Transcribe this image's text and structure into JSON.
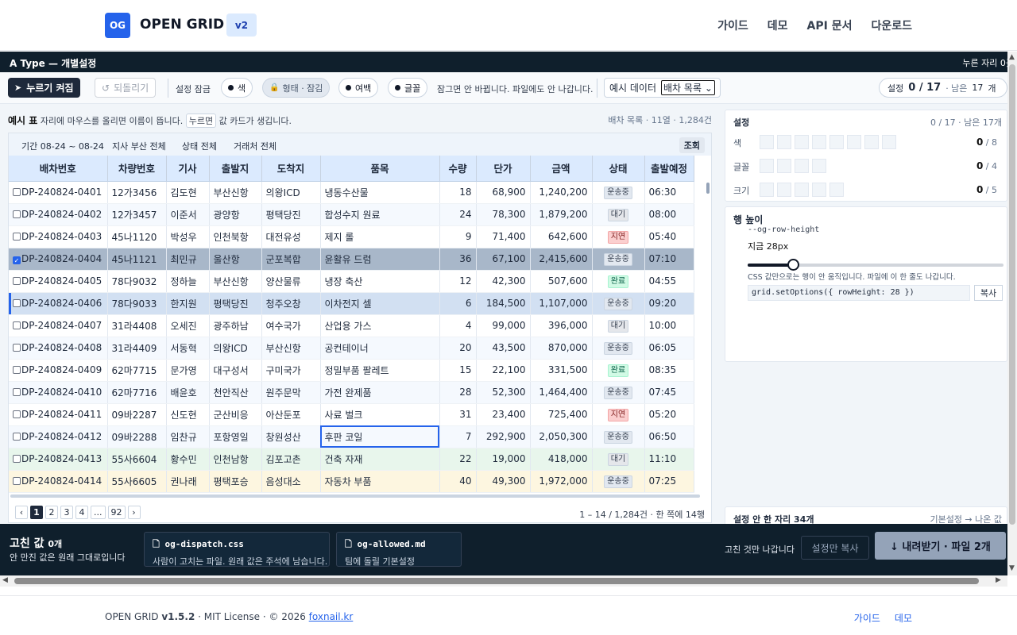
{
  "nav": {
    "logo": "OG",
    "brand": "OPEN GRID",
    "version": "v2",
    "links": [
      "가이드",
      "데모",
      "API 문서",
      "다운로드"
    ]
  },
  "app": {
    "title": "A Type — 개별설정",
    "title_right": "누른 자리 0곳"
  },
  "toolbar": {
    "press_btn": "누르기 켜짐",
    "undo_btn": "되돌리기",
    "lock_label": "설정 잠금",
    "pills": [
      "색",
      "형태 · 잠김",
      "여백",
      "글꼴"
    ],
    "lock_note": "잠그면 안 바뀝니다. 파일에도 안 나갑니다.",
    "sample_label": "예시 데이터",
    "sample_value": "배차 목록",
    "set_label": "설정",
    "set_value": "0 / 17",
    "set_remain_label": "· 남은",
    "set_remain": "17",
    "set_unit": "개"
  },
  "left": {
    "hdr_title": "예시 표",
    "hdr_text1": "자리에 마우스를 올리면 이름이 뜹니다.",
    "hdr_key": "누르면",
    "hdr_text2": "값 카드가 생깁니다.",
    "hdr_right": "배차 목록 · 11열 · 1,284건",
    "filters": [
      "기간 08-24 ~ 08-24",
      "지사 부산 전체",
      "상태 전체",
      "거래처 전체"
    ],
    "filter_go": "조회",
    "columns": [
      "배차번호",
      "차량번호",
      "기사",
      "출발지",
      "도착지",
      "품목",
      "수량",
      "단가",
      "금액",
      "상태",
      "출발예정"
    ],
    "rows": [
      [
        "DP-240824-0401",
        "12가3456",
        "김도현",
        "부산신항",
        "의왕ICD",
        "냉동수산물",
        "18",
        "68,900",
        "1,240,200",
        "운송중",
        "06:30"
      ],
      [
        "DP-240824-0402",
        "12가3457",
        "이준서",
        "광양항",
        "평택당진",
        "합성수지 원료",
        "24",
        "78,300",
        "1,879,200",
        "대기",
        "08:00"
      ],
      [
        "DP-240824-0403",
        "45나1120",
        "박성우",
        "인천북항",
        "대전유성",
        "제지 롤",
        "9",
        "71,400",
        "642,600",
        "지연",
        "05:40"
      ],
      [
        "DP-240824-0404",
        "45나1121",
        "최민규",
        "울산항",
        "군포복합",
        "윤활유 드럼",
        "36",
        "67,100",
        "2,415,600",
        "운송중",
        "07:10"
      ],
      [
        "DP-240824-0405",
        "78다9032",
        "정하늘",
        "부산신항",
        "양산물류",
        "냉장 축산",
        "12",
        "42,300",
        "507,600",
        "완료",
        "04:55"
      ],
      [
        "DP-240824-0406",
        "78다9033",
        "한지원",
        "평택당진",
        "청주오창",
        "이차전지 셀",
        "6",
        "184,500",
        "1,107,000",
        "운송중",
        "09:20"
      ],
      [
        "DP-240824-0407",
        "31라4408",
        "오세진",
        "광주하남",
        "여수국가",
        "산업용 가스",
        "4",
        "99,000",
        "396,000",
        "대기",
        "10:00"
      ],
      [
        "DP-240824-0408",
        "31라4409",
        "서동혁",
        "의왕ICD",
        "부산신항",
        "공컨테이너",
        "20",
        "43,500",
        "870,000",
        "운송중",
        "06:05"
      ],
      [
        "DP-240824-0409",
        "62마7715",
        "문가영",
        "대구성서",
        "구미국가",
        "정밀부품 팔레트",
        "15",
        "22,100",
        "331,500",
        "완료",
        "08:35"
      ],
      [
        "DP-240824-0410",
        "62마7716",
        "배윤호",
        "천안직산",
        "원주문막",
        "가전 완제품",
        "28",
        "52,300",
        "1,464,400",
        "운송중",
        "07:45"
      ],
      [
        "DP-240824-0411",
        "09바2287",
        "신도현",
        "군산비응",
        "아산둔포",
        "사료 벌크",
        "31",
        "23,400",
        "725,400",
        "지연",
        "05:20"
      ],
      [
        "DP-240824-0412",
        "09바2288",
        "임찬규",
        "포항영일",
        "창원성산",
        "후판 코일",
        "7",
        "292,900",
        "2,050,300",
        "운송중",
        "06:50"
      ],
      [
        "DP-240824-0413",
        "55사6604",
        "황수민",
        "인천남항",
        "김포고촌",
        "건축 자재",
        "22",
        "19,000",
        "418,000",
        "대기",
        "11:10"
      ],
      [
        "DP-240824-0414",
        "55사6605",
        "권나래",
        "평택포승",
        "음성대소",
        "자동차 부품",
        "40",
        "49,300",
        "1,972,000",
        "운송중",
        "07:25"
      ]
    ],
    "pages": [
      "‹",
      "1",
      "2",
      "3",
      "4",
      "...",
      "92",
      "›"
    ],
    "page_info": "1 – 14 / 1,284건 · 한 쪽에 14행"
  },
  "right": {
    "settings_title": "설정",
    "settings_meta": "0 / 17 · 남은 17개",
    "set_rows": [
      {
        "label": "색",
        "count": "0",
        "total": "/ 8"
      },
      {
        "label": "글꼴",
        "count": "0",
        "total": "/ 4"
      },
      {
        "label": "크기",
        "count": "0",
        "total": "/ 5"
      }
    ],
    "rowh_title": "행 높이",
    "rowh_var": "--og-row-height",
    "rowh_now": "지금 28px",
    "rowh_note": "CSS 값만으로는 행이 안 움직입니다. 파일에 이 한 줄도 나갑니다.",
    "rowh_code": "grid.setOptions({ rowHeight: 28 })",
    "rowh_copy": "복사",
    "unset_title": "설정 안 한 자리 34개",
    "unset_meta": "기본설정 → 나온 값"
  },
  "bottom": {
    "title": "고친 값",
    "title_count": "0개",
    "sub": "안 만진 값은 원래 그대로입니다",
    "files": [
      {
        "name": "og-dispatch.css",
        "desc": "사람이 고치는 파일. 원래 값은 주석에 남습니다."
      },
      {
        "name": "og-allowed.md",
        "desc": "팀에 돌릴 기본설정"
      }
    ],
    "right_text": "고친 것만 나갑니다",
    "copy_btn": "설정만 복사",
    "download_btn": "↓ 내려받기 · 파일 2개"
  },
  "footer": {
    "left_prefix": "OPEN GRID",
    "version": "v1.5.2",
    "license": "· MIT License · © 2026",
    "link": "foxnail.kr",
    "links": [
      "가이드",
      "데모"
    ]
  }
}
